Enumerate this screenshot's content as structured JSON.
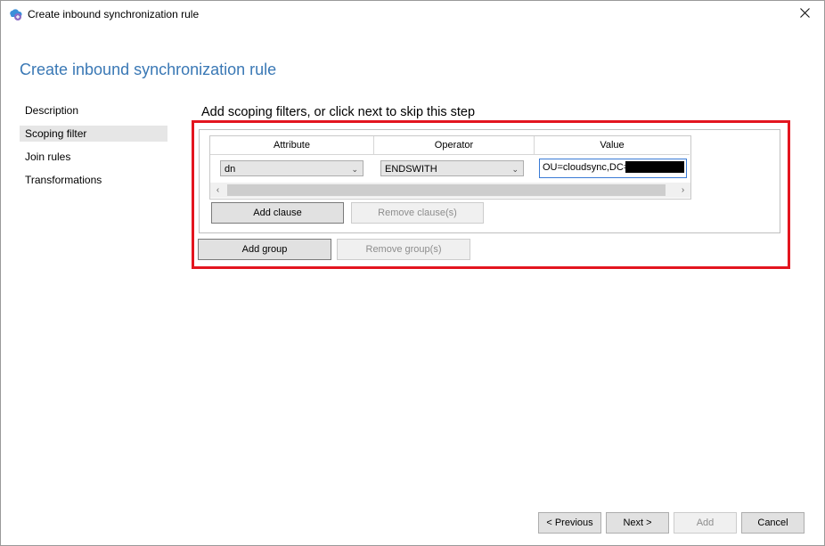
{
  "window": {
    "title": "Create inbound synchronization rule",
    "close_glyph": "✕"
  },
  "page": {
    "heading": "Create inbound synchronization rule",
    "step_title": "Add scoping filters, or click next to skip this step"
  },
  "nav": {
    "items": [
      {
        "label": "Description"
      },
      {
        "label": "Scoping filter",
        "selected": true
      },
      {
        "label": "Join rules"
      },
      {
        "label": "Transformations"
      }
    ]
  },
  "grid": {
    "columns": [
      "Attribute",
      "Operator",
      "Value"
    ],
    "rows": [
      {
        "attribute": "dn",
        "operator": "ENDSWITH",
        "value": "OU=cloudsync,DC="
      }
    ],
    "scroll_left": "‹",
    "scroll_right": "›"
  },
  "buttons": {
    "add_clause": "Add clause",
    "remove_clause": "Remove clause(s)",
    "add_group": "Add group",
    "remove_group": "Remove group(s)",
    "previous": "< Previous",
    "next": "Next >",
    "add": "Add",
    "cancel": "Cancel"
  },
  "icons": {
    "app": "sync-app-icon",
    "close": "close-icon",
    "dropdown": "chevron-down-icon"
  },
  "colors": {
    "heading": "#3a78b5",
    "highlight": "#e3151f",
    "selected_nav": "#e6e6e6"
  }
}
